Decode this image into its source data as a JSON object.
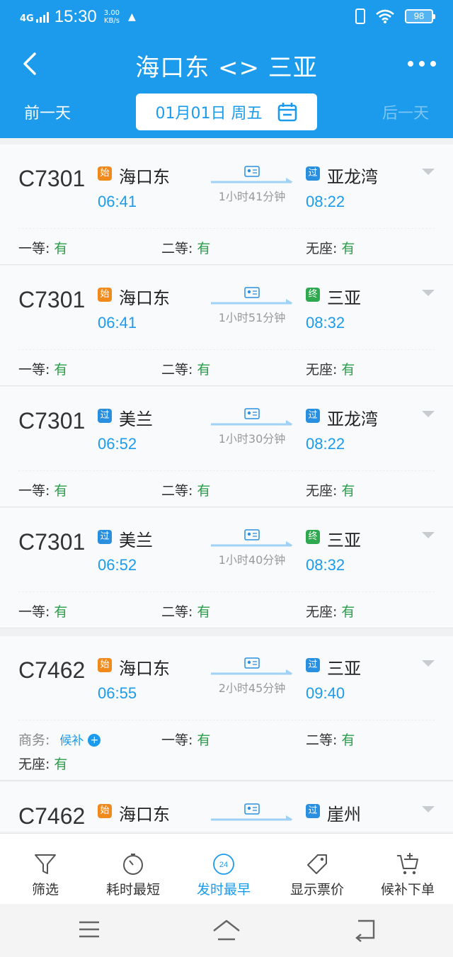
{
  "status_bar": {
    "network": "4G",
    "time": "15:30",
    "speed_value": "3.00",
    "speed_unit": "KB/s",
    "battery": "98"
  },
  "nav": {
    "route_title": "海口东 <> 三亚",
    "back_icon": "back-arrow-icon",
    "more_icon": "more-dots-icon"
  },
  "date_bar": {
    "prev_day": "前一天",
    "date": "01月01日 周五",
    "next_day": "后一天"
  },
  "colors": {
    "primary": "#1c9bec",
    "origin_badge": "#f08a1c",
    "pass_badge": "#2b8fe0",
    "terminal_badge": "#2ea94f",
    "available": "#2a9d48"
  },
  "trains": [
    {
      "no": "C7301",
      "from_tag": "始",
      "from_type": "origin",
      "from": "海口东",
      "dep": "06:41",
      "duration": "1小时41分钟",
      "to_tag": "过",
      "to_type": "pass",
      "to": "亚龙湾",
      "arr": "08:22",
      "seats": [
        {
          "label": "一等:",
          "value": "有"
        },
        {
          "label": "二等:",
          "value": "有"
        },
        {
          "label": "无座:",
          "value": "有"
        }
      ]
    },
    {
      "no": "C7301",
      "from_tag": "始",
      "from_type": "origin",
      "from": "海口东",
      "dep": "06:41",
      "duration": "1小时51分钟",
      "to_tag": "终",
      "to_type": "terminal",
      "to": "三亚",
      "arr": "08:32",
      "seats": [
        {
          "label": "一等:",
          "value": "有"
        },
        {
          "label": "二等:",
          "value": "有"
        },
        {
          "label": "无座:",
          "value": "有"
        }
      ]
    },
    {
      "no": "C7301",
      "from_tag": "过",
      "from_type": "pass",
      "from": "美兰",
      "dep": "06:52",
      "duration": "1小时30分钟",
      "to_tag": "过",
      "to_type": "pass",
      "to": "亚龙湾",
      "arr": "08:22",
      "seats": [
        {
          "label": "一等:",
          "value": "有"
        },
        {
          "label": "二等:",
          "value": "有"
        },
        {
          "label": "无座:",
          "value": "有"
        }
      ]
    },
    {
      "no": "C7301",
      "from_tag": "过",
      "from_type": "pass",
      "from": "美兰",
      "dep": "06:52",
      "duration": "1小时40分钟",
      "to_tag": "终",
      "to_type": "terminal",
      "to": "三亚",
      "arr": "08:32",
      "seats": [
        {
          "label": "一等:",
          "value": "有"
        },
        {
          "label": "二等:",
          "value": "有"
        },
        {
          "label": "无座:",
          "value": "有"
        }
      ]
    },
    {
      "no": "C7462",
      "from_tag": "始",
      "from_type": "origin",
      "from": "海口东",
      "dep": "06:55",
      "duration": "2小时45分钟",
      "to_tag": "过",
      "to_type": "pass",
      "to": "三亚",
      "arr": "09:40",
      "seats": [
        {
          "label": "商务:",
          "value": "",
          "waitlist": "候补"
        },
        {
          "label": "一等:",
          "value": "有"
        },
        {
          "label": "二等:",
          "value": "有"
        },
        {
          "label": "无座:",
          "value": "有"
        }
      ]
    },
    {
      "no": "C7462",
      "from_tag": "始",
      "from_type": "origin",
      "from": "海口东",
      "dep": "",
      "duration": "",
      "to_tag": "过",
      "to_type": "pass",
      "to": "崖州",
      "arr": "",
      "seats": []
    }
  ],
  "toolbar": {
    "filter": "筛选",
    "shortest": "耗时最短",
    "earliest": "发时最早",
    "earliest_badge": "24",
    "show_price": "显示票价",
    "waitlist_order": "候补下单"
  }
}
